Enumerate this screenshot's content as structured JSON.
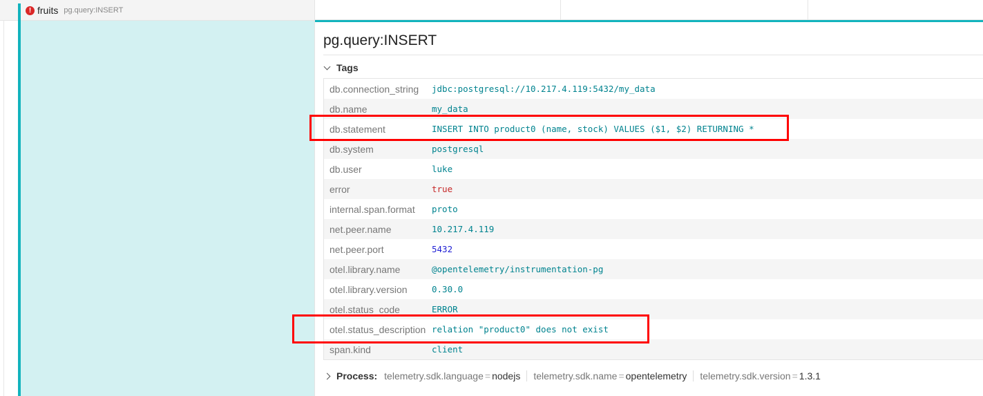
{
  "span": {
    "service": "fruits",
    "operation": "pg.query:INSERT",
    "error_symbol": "!"
  },
  "detail": {
    "title": "pg.query:INSERT",
    "tags_label": "Tags",
    "tags": [
      {
        "key": "db.connection_string",
        "value": "jdbc:postgresql://10.217.4.119:5432/my_data",
        "type": "string"
      },
      {
        "key": "db.name",
        "value": "my_data",
        "type": "string"
      },
      {
        "key": "db.statement",
        "value": "INSERT INTO product0 (name, stock) VALUES ($1, $2) RETURNING *",
        "type": "string"
      },
      {
        "key": "db.system",
        "value": "postgresql",
        "type": "string"
      },
      {
        "key": "db.user",
        "value": "luke",
        "type": "string"
      },
      {
        "key": "error",
        "value": "true",
        "type": "bool-err"
      },
      {
        "key": "internal.span.format",
        "value": "proto",
        "type": "string"
      },
      {
        "key": "net.peer.name",
        "value": "10.217.4.119",
        "type": "string"
      },
      {
        "key": "net.peer.port",
        "value": "5432",
        "type": "number"
      },
      {
        "key": "otel.library.name",
        "value": "@opentelemetry/instrumentation-pg",
        "type": "string"
      },
      {
        "key": "otel.library.version",
        "value": "0.30.0",
        "type": "string"
      },
      {
        "key": "otel.status_code",
        "value": "ERROR",
        "type": "string"
      },
      {
        "key": "otel.status_description",
        "value": "relation \"product0\" does not exist",
        "type": "string"
      },
      {
        "key": "span.kind",
        "value": "client",
        "type": "string"
      }
    ],
    "process": {
      "label": "Process:",
      "items": [
        {
          "key": "telemetry.sdk.language",
          "value": "nodejs"
        },
        {
          "key": "telemetry.sdk.name",
          "value": "opentelemetry"
        },
        {
          "key": "telemetry.sdk.version",
          "value": "1.3.1"
        }
      ]
    }
  },
  "colors": {
    "accent": "#12b3bd",
    "error": "#db2828",
    "highlight": "#ff0000"
  }
}
